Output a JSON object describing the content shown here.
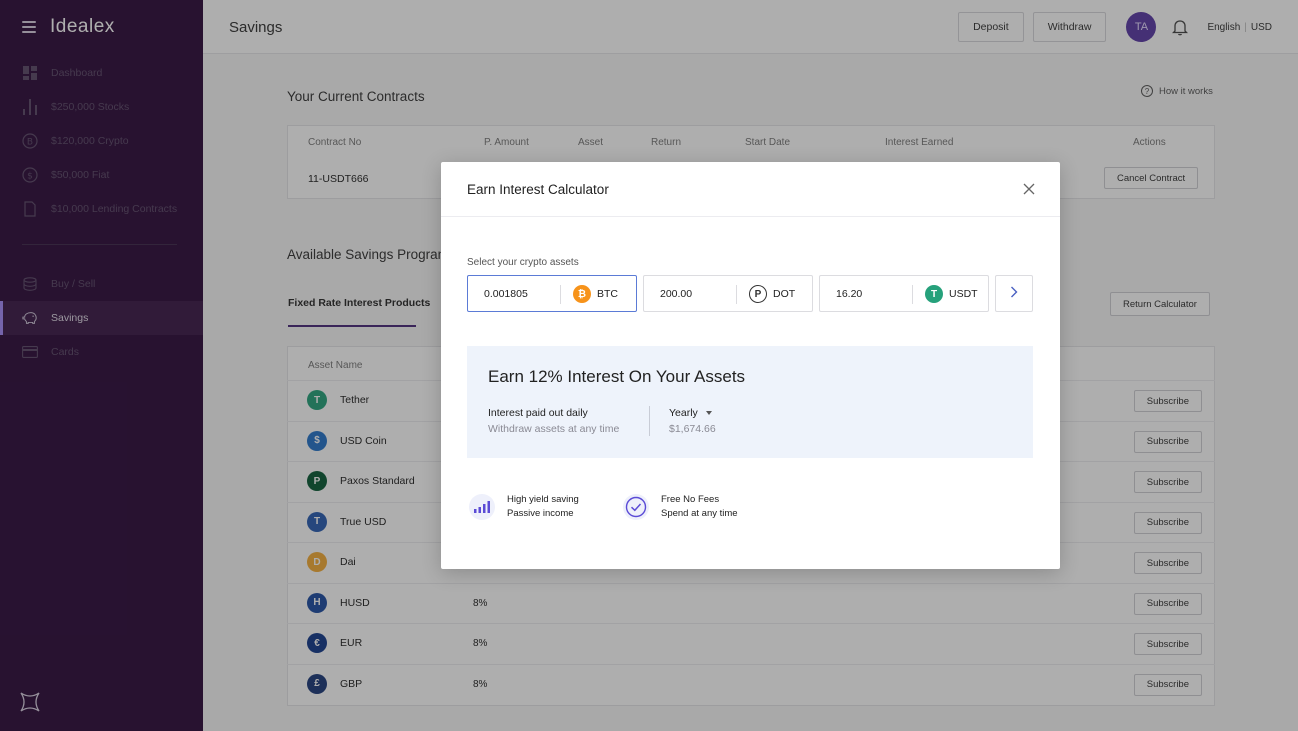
{
  "app": {
    "name": "Idealex"
  },
  "sidebar": {
    "items": [
      {
        "label": "Dashboard"
      },
      {
        "label": "$250,000 Stocks"
      },
      {
        "label": "$120,000 Crypto"
      },
      {
        "label": "$50,000 Fiat"
      },
      {
        "label": "$10,000  Lending Contracts"
      },
      {
        "label": "Buy / Sell"
      },
      {
        "label": "Savings"
      },
      {
        "label": "Cards"
      }
    ],
    "active": "Savings"
  },
  "header": {
    "title": "Savings",
    "deposit_label": "Deposit",
    "withdraw_label": "Withdraw",
    "avatar_initials": "TA",
    "language": "English",
    "currency": "USD"
  },
  "contracts": {
    "title": "Your Current Contracts",
    "how_it_works": "How it works",
    "columns": [
      "Contract No",
      "P. Amount",
      "Asset",
      "Return",
      "Start Date",
      "Interest Earned",
      "Actions"
    ],
    "rows": [
      {
        "contract_no": "11-USDT666",
        "action": "Cancel Contract"
      }
    ]
  },
  "programs": {
    "title": "Available Savings Programs",
    "tab_active": "Fixed Rate Interest Products",
    "return_calculator": "Return Calculator",
    "column_asset": "Asset Name",
    "subscribe_label": "Subscribe",
    "assets": [
      {
        "name": "Tether",
        "rate": "",
        "color": "#26a17b",
        "glyph": "T"
      },
      {
        "name": "USD Coin",
        "rate": "",
        "color": "#2775ca",
        "glyph": "$"
      },
      {
        "name": "Paxos Standard",
        "rate": "",
        "color": "#0a5c36",
        "glyph": "P"
      },
      {
        "name": "True USD",
        "rate": "",
        "color": "#2b5fb3",
        "glyph": "T"
      },
      {
        "name": "Dai",
        "rate": "",
        "color": "#f5ac37",
        "glyph": "D"
      },
      {
        "name": "HUSD",
        "rate": "8%",
        "color": "#1f4ea3",
        "glyph": "H"
      },
      {
        "name": "EUR",
        "rate": "8%",
        "color": "#143a8c",
        "glyph": "€"
      },
      {
        "name": "GBP",
        "rate": "8%",
        "color": "#1d3a7a",
        "glyph": "£"
      }
    ]
  },
  "modal": {
    "title": "Earn Interest Calculator",
    "select_label": "Select your crypto assets",
    "assets": [
      {
        "value": "0.001805",
        "symbol": "BTC",
        "color": "#f7931a",
        "glyph": "₿"
      },
      {
        "value": "200.00",
        "symbol": "DOT",
        "color": "#ffffff",
        "glyph": "P"
      },
      {
        "value": "16.20",
        "symbol": "USDT",
        "color": "#26a17b",
        "glyph": "T"
      }
    ],
    "earn_title": "Earn 12% Interest On Your Assets",
    "line1": "Interest paid out daily",
    "line2": "Withdraw assets at any time",
    "period": "Yearly",
    "amount": "$1,674.66",
    "features": [
      {
        "title": "High yield saving",
        "subtitle": "Passive income",
        "icon": "bar-chart-icon",
        "color": "#5b4bd6"
      },
      {
        "title": "Free No Fees",
        "subtitle": "Spend at any time",
        "icon": "check-circle-icon",
        "color": "#5b4bd6"
      }
    ]
  }
}
